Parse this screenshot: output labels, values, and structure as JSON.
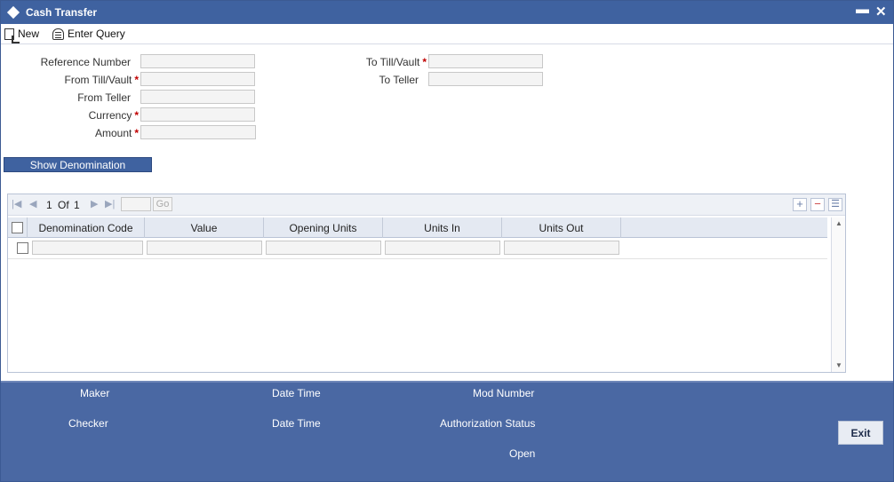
{
  "window": {
    "title": "Cash Transfer",
    "minimize_glyph": "▬",
    "close_glyph": "✕"
  },
  "toolbar": {
    "new_label": "New",
    "enter_query_label": "Enter Query"
  },
  "form": {
    "reference_number_label": "Reference Number",
    "from_till_vault_label": "From Till/Vault",
    "from_teller_label": "From Teller",
    "currency_label": "Currency",
    "amount_label": "Amount",
    "to_till_vault_label": "To Till/Vault",
    "to_teller_label": "To Teller",
    "required_mark": "*",
    "reference_number_value": "",
    "from_till_vault_value": "",
    "from_teller_value": "",
    "currency_value": "",
    "amount_value": "",
    "to_till_vault_value": "",
    "to_teller_value": ""
  },
  "show_denomination_label": "Show Denomination",
  "grid": {
    "pager": {
      "first_glyph": "|◀",
      "prev_glyph": "◀",
      "page": "1",
      "of_label": "Of",
      "total": "1",
      "next_glyph": "▶",
      "last_glyph": "▶|",
      "go_label": "Go"
    },
    "actions": {
      "add_glyph": "+",
      "delete_glyph": "−",
      "view_glyph": "☰"
    },
    "columns": [
      "Denomination Code",
      "Value",
      "Opening Units",
      "Units In",
      "Units Out"
    ],
    "rows": [
      {
        "denomination_code": "",
        "value": "",
        "opening_units": "",
        "units_in": "",
        "units_out": ""
      }
    ]
  },
  "footer": {
    "maker_label": "Maker",
    "maker_date_time_label": "Date Time",
    "mod_number_label": "Mod Number",
    "checker_label": "Checker",
    "checker_date_time_label": "Date Time",
    "authorization_status_label": "Authorization Status",
    "record_status": "Open",
    "exit_label": "Exit"
  },
  "colors": {
    "titlebar": "#3f62a0",
    "footer": "#4a68a3",
    "required": "#c00000"
  }
}
